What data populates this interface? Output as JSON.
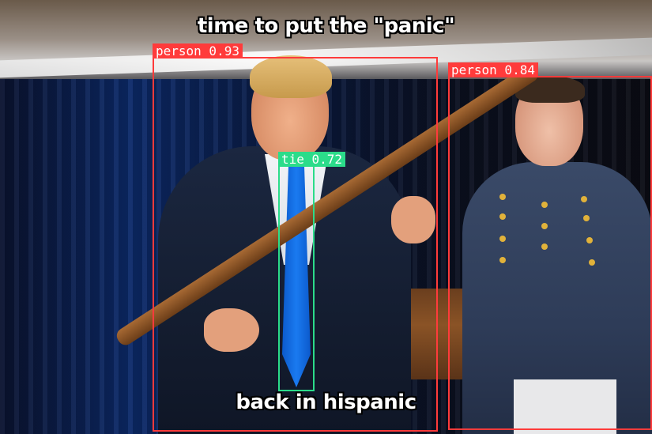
{
  "captions": {
    "top": "time to put the \"panic\"",
    "bottom": "back in hispanic"
  },
  "detections": [
    {
      "label": "person 0.93",
      "class": "person",
      "score": 0.93,
      "color": "#ff3b3b"
    },
    {
      "label": "person 0.84",
      "class": "person",
      "score": 0.84,
      "color": "#ff3b3b"
    },
    {
      "label": "tie 0.72",
      "class": "tie",
      "score": 0.72,
      "color": "#2bdc8a"
    }
  ],
  "colors": {
    "person_box": "#ff3b3b",
    "tie_box": "#2bdc8a",
    "caption_text": "#ffffff",
    "caption_outline": "#000000"
  }
}
